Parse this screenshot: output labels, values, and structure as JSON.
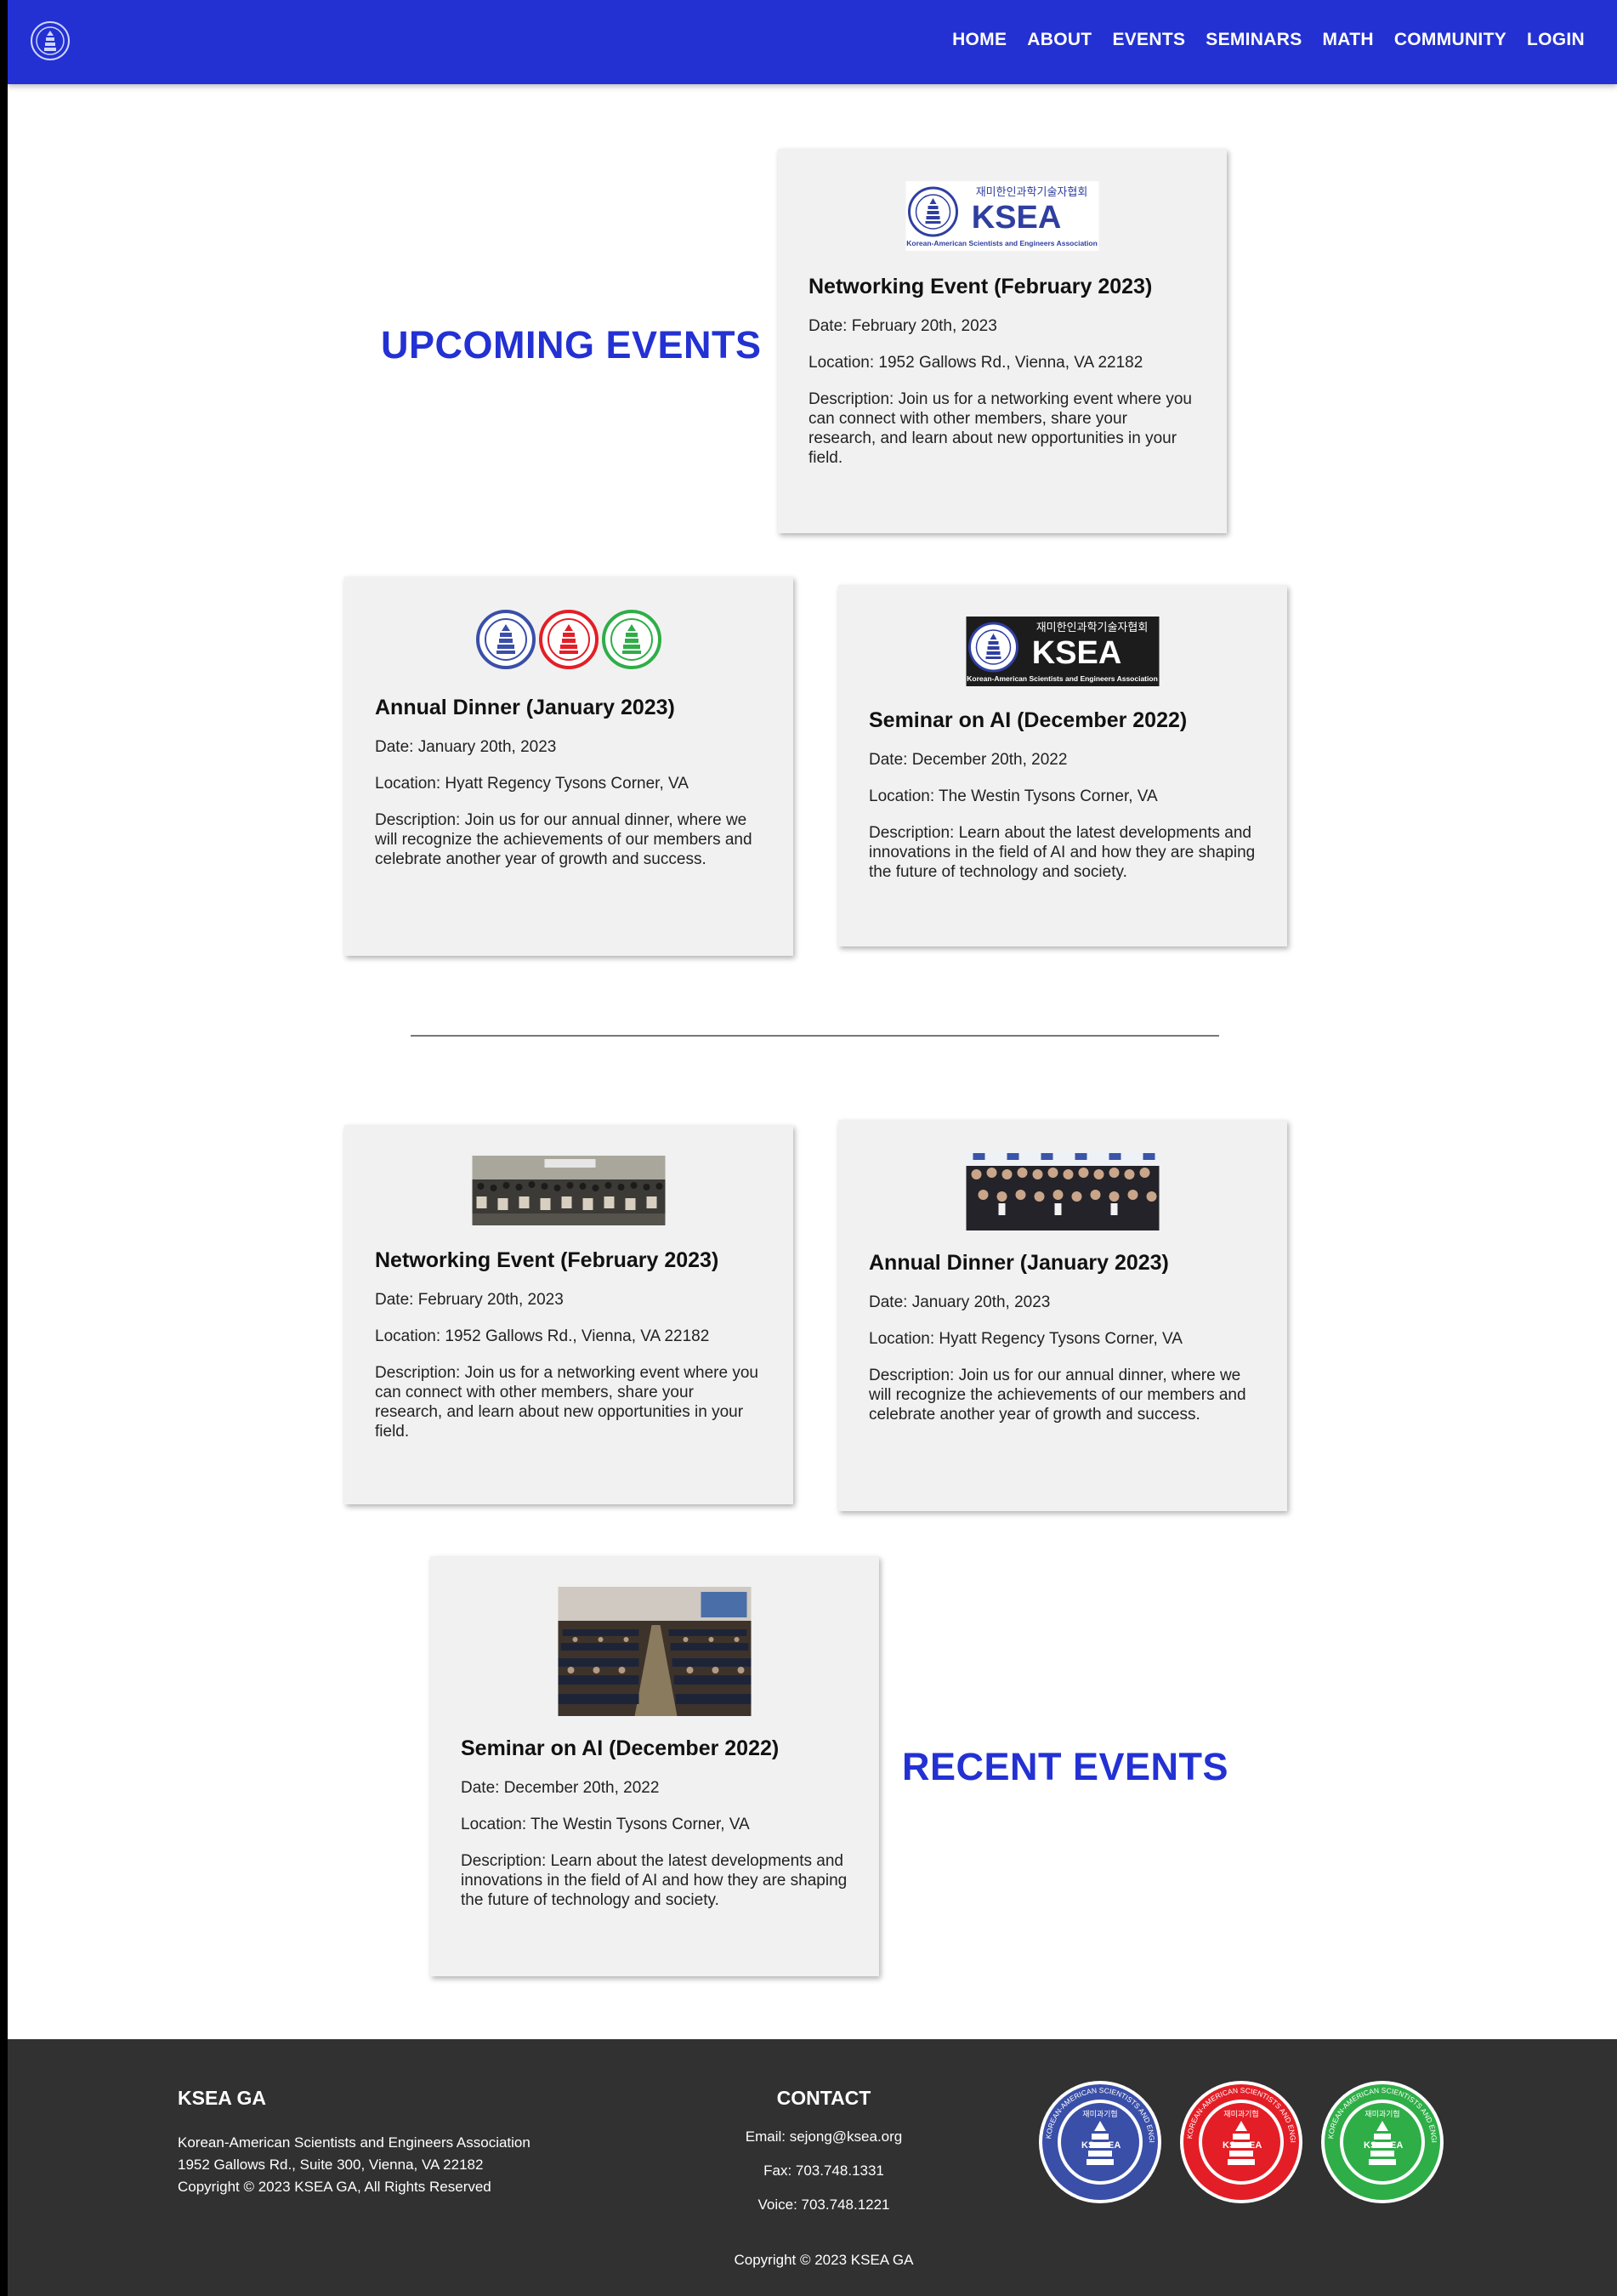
{
  "nav": {
    "logo_icon": "ksea-seal-icon",
    "links": [
      "HOME",
      "ABOUT",
      "EVENTS",
      "SEMINARS",
      "MATH",
      "COMMUNITY",
      "LOGIN"
    ]
  },
  "upcoming": {
    "heading": "UPCOMING EVENTS",
    "cards": [
      {
        "title": "Networking Event (February 2023)",
        "date": "Date: February 20th, 2023",
        "location": "Location: 1952 Gallows Rd., Vienna, VA 22182",
        "description": "Description: Join us for a networking event where you can connect with other members, share your research, and learn about new opportunities in your field.",
        "image": "ksea-logo-white"
      },
      {
        "title": "Annual Dinner (January 2023)",
        "date": "Date: January 20th, 2023",
        "location": "Location: Hyatt Regency Tysons Corner, VA",
        "description": "Description: Join us for our annual dinner, where we will recognize the achievements of our members and celebrate another year of growth and success.",
        "image": "three-seals"
      },
      {
        "title": "Seminar on AI (December 2022)",
        "date": "Date: December 20th, 2022",
        "location": "Location: The Westin Tysons Corner, VA",
        "description": "Description: Learn about the latest developments and innovations in the field of AI and how they are shaping the future of technology and society.",
        "image": "ksea-logo-black"
      }
    ]
  },
  "logo_text": {
    "korean": "재미한인과학기술자협회",
    "acronym": "KSEA",
    "english": "Korean-American Scientists and Engineers Association"
  },
  "recent": {
    "heading": "RECENT EVENTS",
    "cards": [
      {
        "title": "Networking Event (February 2023)",
        "date": "Date: February 20th, 2023",
        "location": "Location: 1952 Gallows Rd., Vienna, VA 22182",
        "description": "Description: Join us for a networking event where you can connect with other members, share your research, and learn about new opportunities in your field.",
        "image": "group-photo"
      },
      {
        "title": "Annual Dinner (January 2023)",
        "date": "Date: January 20th, 2023",
        "location": "Location: Hyatt Regency Tysons Corner, VA",
        "description": "Description: Join us for our annual dinner, where we will recognize the achievements of our members and celebrate another year of growth and success.",
        "image": "dinner-group-photo"
      },
      {
        "title": "Seminar on AI (December 2022)",
        "date": "Date: December 20th, 2022",
        "location": "Location: The Westin Tysons Corner, VA",
        "description": "Description: Learn about the latest developments and innovations in the field of AI and how they are shaping the future of technology and society.",
        "image": "auditorium-photo"
      }
    ]
  },
  "footer": {
    "org_title": "KSEA GA",
    "org_name": "Korean-American Scientists and Engineers Association",
    "address": "1952 Gallows Rd., Suite 300, Vienna, VA 22182",
    "org_copyright": "Copyright © 2023 KSEA GA, All Rights Reserved",
    "contact_title": "CONTACT",
    "email": "Email: sejong@ksea.org",
    "fax": "Fax: 703.748.1331",
    "voice": "Voice: 703.748.1221",
    "copyright": "Copyright © 2023 KSEA GA",
    "seal_text": "KOREAN-AMERICAN SCIENTISTS AND ENGINEERS 1971 ASSOCIATION",
    "seal_korean": "재미과기협",
    "seal_ks": "KS",
    "seal_ea": "EA"
  },
  "colors": {
    "brand_blue": "#2331d3",
    "seal_blue": "#3a4fa8",
    "seal_red": "#e41e26",
    "seal_green": "#2fae47",
    "card_bg": "#f1f1f1",
    "footer_bg": "#313131"
  }
}
